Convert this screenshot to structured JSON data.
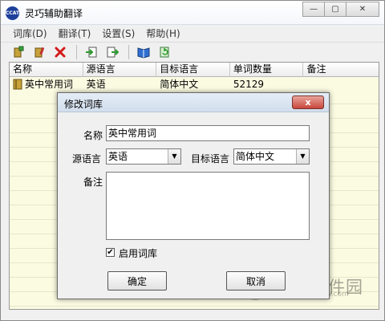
{
  "window": {
    "title": "灵巧辅助翻译",
    "app_icon_text": "CCAT",
    "minimize": "—",
    "maximize": "▢",
    "close": "✕"
  },
  "menu": [
    "词库(D)",
    "翻译(T)",
    "设置(S)",
    "帮助(H)"
  ],
  "toolbar": {
    "icons": [
      "add-dictionary-icon",
      "edit-dictionary-icon",
      "delete-icon",
      "import-icon",
      "export-icon",
      "book-icon",
      "refresh-icon"
    ]
  },
  "table": {
    "columns": [
      "名称",
      "源语言",
      "目标语言",
      "单词数量",
      "备注"
    ],
    "rows": [
      {
        "name": "英中常用词",
        "source": "英语",
        "target": "简体中文",
        "count": "52129",
        "note": ""
      }
    ]
  },
  "dialog": {
    "title": "修改词库",
    "close": "x",
    "name_label": "名称",
    "name_value": "英中常用词",
    "source_label": "源语言",
    "source_value": "英语",
    "target_label": "目标语言",
    "target_value": "简体中文",
    "note_label": "备注",
    "note_value": "",
    "enable_label": "启用词库",
    "enable_checked": "✔",
    "ok_label": "确定",
    "cancel_label": "取消"
  },
  "watermark": {
    "main": "当下软件园",
    "sub": "www.downxia.com"
  },
  "colors": {
    "list_bg": "#fbfbe2",
    "dialog_close": "#c9473b"
  }
}
